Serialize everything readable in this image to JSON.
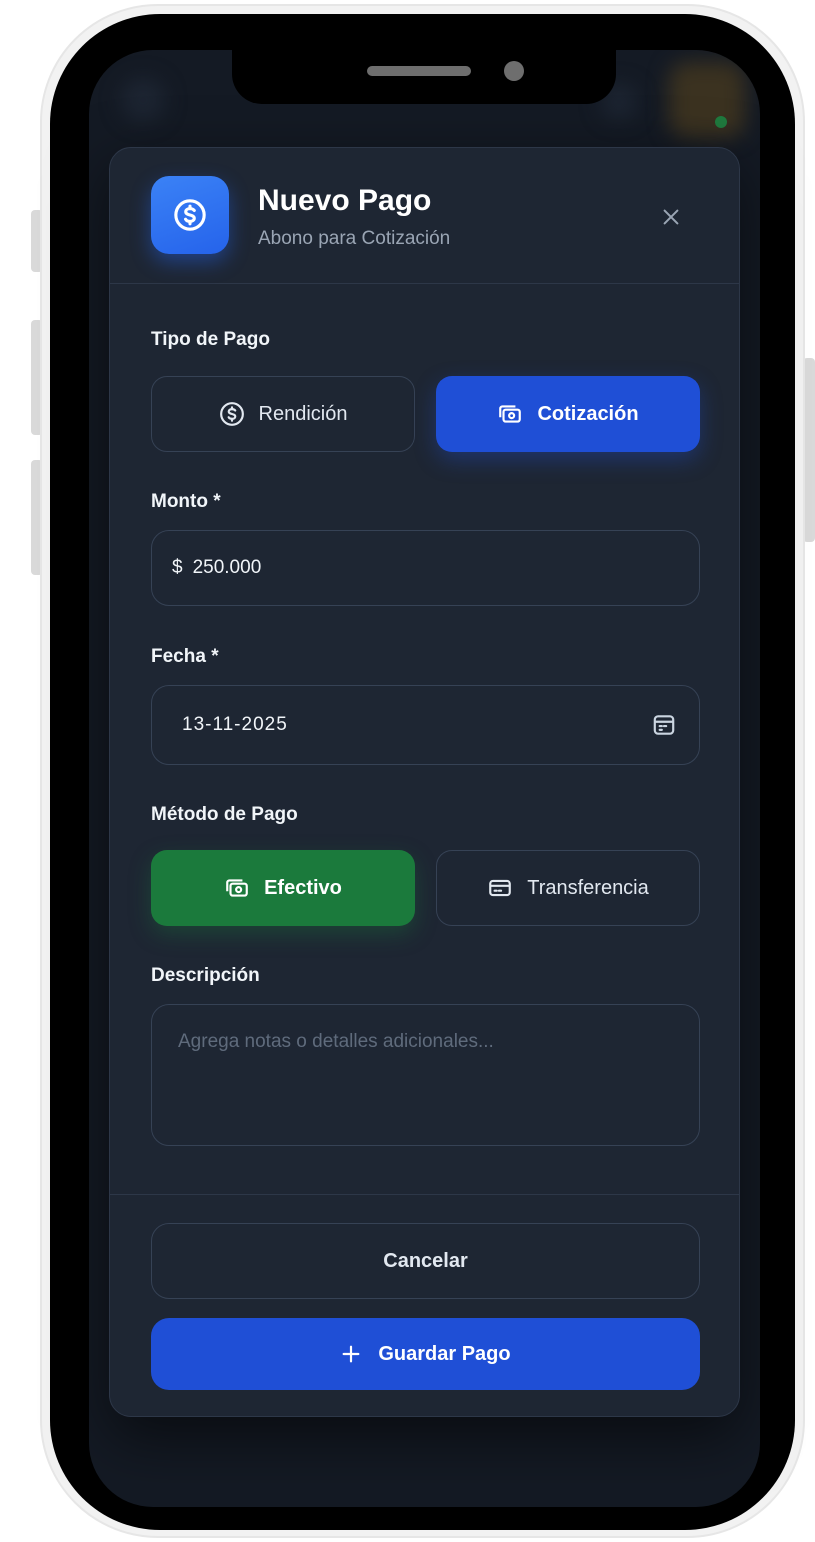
{
  "modal": {
    "title": "Nuevo Pago",
    "subtitle": "Abono para Cotización",
    "header_icon": "dollar-circle-icon",
    "close_icon": "close-icon"
  },
  "tipo_pago": {
    "label": "Tipo de Pago",
    "options": [
      {
        "label": "Rendición",
        "icon": "dollar-circle-icon",
        "selected": false
      },
      {
        "label": "Cotización",
        "icon": "cash-icon",
        "selected": true
      }
    ]
  },
  "monto": {
    "label": "Monto *",
    "currency": "$",
    "value": "250.000"
  },
  "fecha": {
    "label": "Fecha *",
    "value": "13-11-2025",
    "icon": "calendar-icon"
  },
  "metodo_pago": {
    "label": "Método de Pago",
    "options": [
      {
        "label": "Efectivo",
        "icon": "cash-icon",
        "selected": true
      },
      {
        "label": "Transferencia",
        "icon": "credit-card-icon",
        "selected": false
      }
    ]
  },
  "descripcion": {
    "label": "Descripción",
    "placeholder": "Agrega notas o detalles adicionales..."
  },
  "actions": {
    "cancel_label": "Cancelar",
    "save_label": "Guardar Pago",
    "save_icon": "plus-icon"
  },
  "colors": {
    "primary_blue": "#1f4fd6",
    "success_green": "#1b7a3c",
    "modal_bg": "#1e2633",
    "border": "#364255"
  }
}
